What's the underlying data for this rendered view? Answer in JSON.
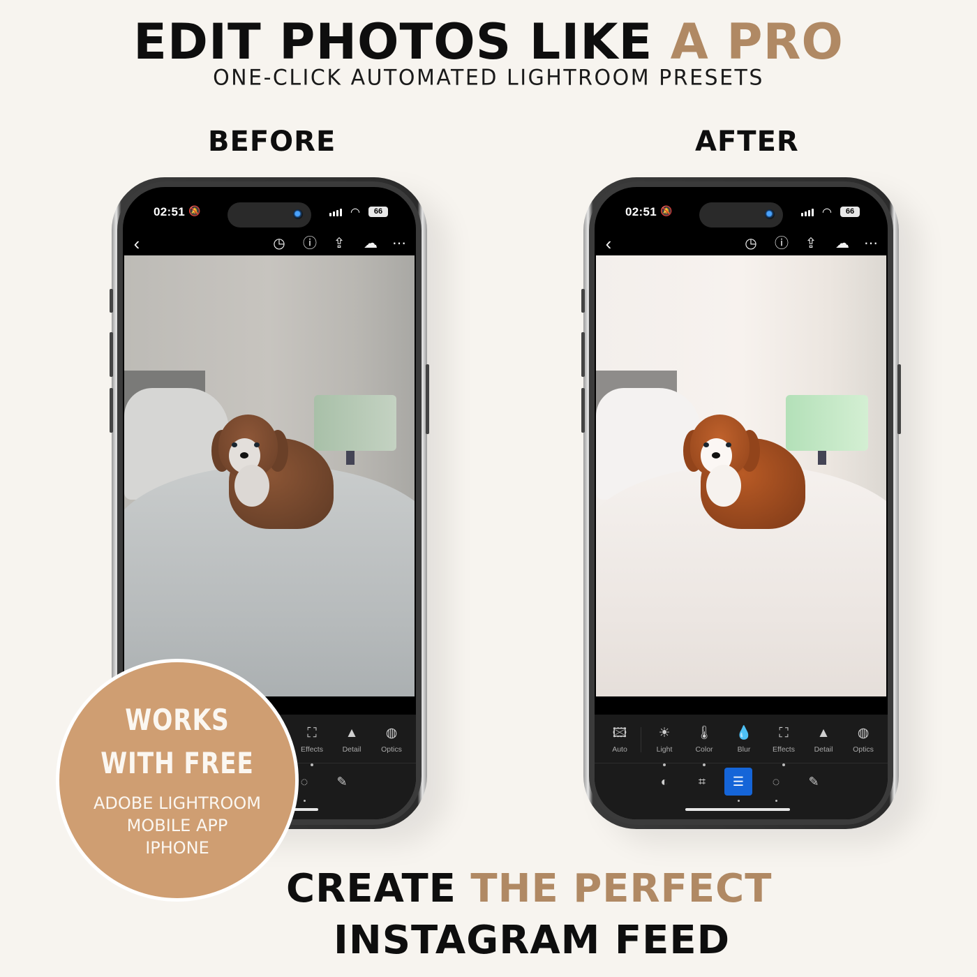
{
  "headline": {
    "part1": "EDIT PHOTOS LIKE ",
    "part2": "A PRO"
  },
  "subheadline": "ONE-CLICK AUTOMATED LIGHTROOM PRESETS",
  "labels": {
    "before": "BEFORE",
    "after": "AFTER"
  },
  "colors": {
    "accent": "#b08964",
    "badge": "#cf9e72",
    "background": "#f7f4ef",
    "active_mode": "#1565d8"
  },
  "phones": {
    "status": {
      "time": "02:51",
      "battery": "66",
      "silent_icon": "bell-slash-icon",
      "signal_icon": "signal-icon",
      "wifi_icon": "wifi-icon"
    },
    "top_toolbar": {
      "back": "‹",
      "icons": [
        "history-icon",
        "help-icon",
        "share-icon",
        "cloud-synced-icon",
        "more-icon"
      ]
    },
    "tools": [
      {
        "label": "Auto",
        "icon": "auto-icon"
      },
      {
        "label": "Light",
        "icon": "sun-icon"
      },
      {
        "label": "Color",
        "icon": "thermometer-icon"
      },
      {
        "label": "Blur",
        "icon": "drop-icon"
      },
      {
        "label": "Effects",
        "icon": "vignette-icon"
      },
      {
        "label": "Detail",
        "icon": "triangle-icon"
      },
      {
        "label": "Optics",
        "icon": "lens-icon"
      }
    ],
    "modes": [
      {
        "name": "presets",
        "icon": "presets-icon"
      },
      {
        "name": "crop",
        "icon": "crop-icon"
      },
      {
        "name": "edit",
        "icon": "sliders-icon",
        "active": true
      },
      {
        "name": "masking",
        "icon": "masking-icon"
      },
      {
        "name": "healing",
        "icon": "bandage-icon"
      }
    ]
  },
  "badge": {
    "line1": "WORKS",
    "line2": "WITH FREE",
    "line3": "ADOBE LIGHTROOM",
    "line4": "MOBILE APP",
    "line5": "IPHONE"
  },
  "footer": {
    "part1": "CREATE ",
    "part2": "THE PERFECT",
    "line2": "INSTAGRAM FEED"
  }
}
